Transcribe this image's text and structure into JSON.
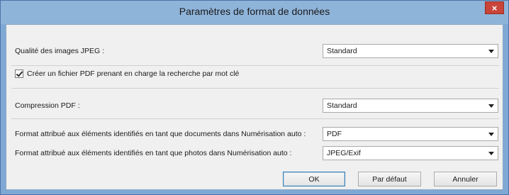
{
  "window": {
    "title": "Paramètres de format de données"
  },
  "title_bar": {
    "close_label": "×"
  },
  "jpeg_quality": {
    "label": "Qualité des images JPEG :",
    "value": "Standard"
  },
  "searchable_pdf": {
    "label": "Créer un fichier PDF prenant en charge la recherche par mot clé",
    "checked": true
  },
  "pdf_compression": {
    "label": "Compression PDF :",
    "value": "Standard"
  },
  "auto_scan_documents": {
    "label": "Format attribué aux éléments identifiés en tant que documents dans Numérisation auto :",
    "value": "PDF"
  },
  "auto_scan_photos": {
    "label": "Format attribué aux éléments identifiés en tant que photos dans Numérisation auto :",
    "value": "JPEG/Exif"
  },
  "buttons": {
    "ok": "OK",
    "defaults": "Par défaut",
    "cancel": "Annuler"
  }
}
